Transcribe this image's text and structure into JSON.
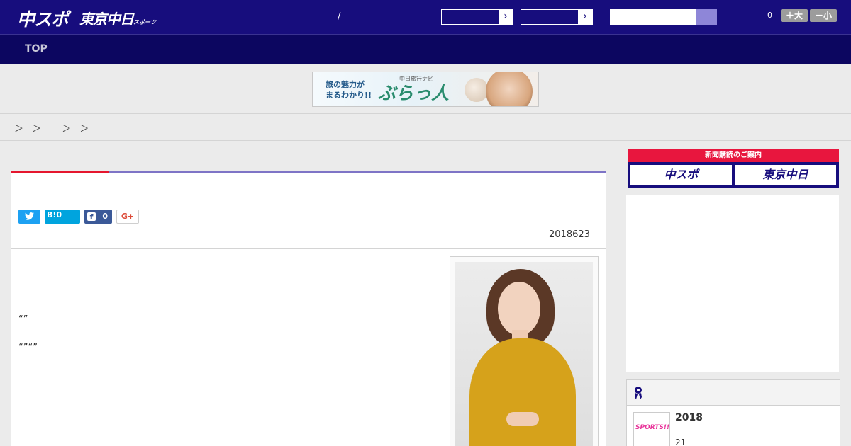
{
  "header": {
    "logo_main": "中スポ",
    "logo_sub": "東京中日",
    "logo_sub_small": "スポーツ",
    "separator": "/",
    "font_count": "0",
    "font_larger": "＋大",
    "font_smaller": "－小"
  },
  "nav": {
    "top": "TOP"
  },
  "banner": {
    "tagline": "旅の魅力が\nまるわかり!!",
    "small_title": "中日旅行ナビ",
    "brand": "ぶらっ人"
  },
  "breadcrumb": "＞ ＞ 　＞ ＞",
  "article": {
    "share_hatena": "B!0",
    "share_facebook_count": "0",
    "share_google": "G+",
    "date": "2018623",
    "quote1": "“”",
    "quote2": "“”“”"
  },
  "sidebar": {
    "subscribe_label": "新聞購読のご案内",
    "subscribe_chuspo": "中スポ",
    "subscribe_tokyo": "東京中日",
    "ranking_title": "2018",
    "ranking_sub": "21",
    "thumb_text": "SPORTS!!"
  },
  "colors": {
    "header_bg": "#170d7d",
    "nav_bg": "#0c0660",
    "accent_red": "#e5162e",
    "accent_purple": "#7e74c6"
  }
}
